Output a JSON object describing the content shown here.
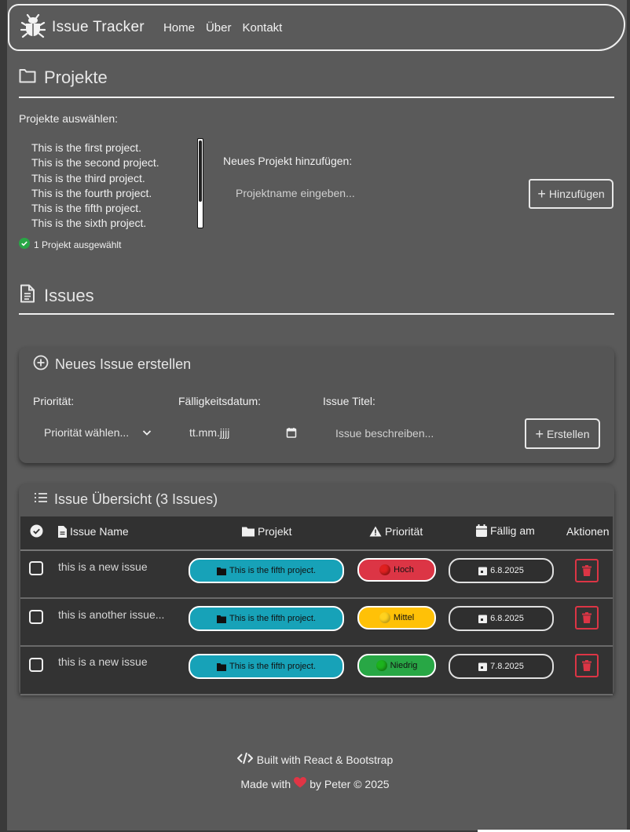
{
  "navbar": {
    "brand": "Issue Tracker",
    "links": [
      "Home",
      "Über",
      "Kontakt"
    ]
  },
  "projects": {
    "title": "Projekte",
    "select_label": "Projekte auswählen:",
    "items": [
      "This is the first project.",
      "This is the second project.",
      "This is the third project.",
      "This is the fourth project.",
      "This is the fifth project.",
      "This is the sixth project."
    ],
    "selected_info": "1 Projekt ausgewählt",
    "add_label": "Neues Projekt hinzufügen:",
    "add_placeholder": "Projektname eingeben...",
    "add_button": "Hinzufügen"
  },
  "issues": {
    "title": "Issues",
    "create": {
      "title": "Neues Issue erstellen",
      "priority_label": "Priorität:",
      "priority_value": "Priorität wählen...",
      "date_label": "Fälligkeitsdatum:",
      "date_value": "tt.mm.jjjj",
      "title_label": "Issue Titel:",
      "title_placeholder": "Issue beschreiben...",
      "create_button": "Erstellen"
    },
    "overview": {
      "title": "Issue Übersicht (3 Issues)",
      "columns": {
        "name": "Issue Name",
        "project": "Projekt",
        "priority": "Priorität",
        "due": "Fällig am",
        "actions": "Aktionen"
      },
      "rows": [
        {
          "name": "this is a new issue",
          "project": "This is the fifth project.",
          "priority": "Hoch",
          "priority_color": "#dc3545",
          "dot_color": "#e02020",
          "due": "6.8.2025"
        },
        {
          "name": "this is another issue...",
          "project": "This is the fifth project.",
          "priority": "Mittel",
          "priority_color": "#ffc107",
          "dot_color": "#ffd21f",
          "due": "6.8.2025"
        },
        {
          "name": "this is a new issue",
          "project": "This is the fifth project.",
          "priority": "Niedrig",
          "priority_color": "#28a745",
          "dot_color": "#1db31d",
          "due": "7.8.2025"
        }
      ]
    }
  },
  "footer": {
    "built_with": "Built with React & Bootstrap",
    "made_with_prefix": "Made with",
    "made_with_suffix": "by Peter © 2025"
  },
  "colors": {
    "background": "#5a5a5a",
    "accent_project": "#17a2b8",
    "danger": "#dc3545"
  }
}
